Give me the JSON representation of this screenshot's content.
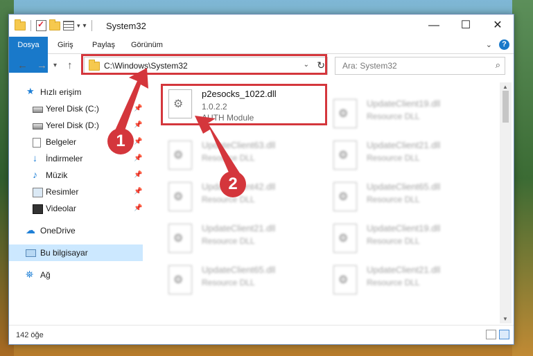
{
  "window": {
    "title": "System32"
  },
  "ribbon": {
    "tabs": [
      "Dosya",
      "Giriş",
      "Paylaş",
      "Görünüm"
    ]
  },
  "address": {
    "path": "C:\\Windows\\System32"
  },
  "search": {
    "placeholder": "Ara: System32"
  },
  "sidebar": {
    "quick_access": "Hızlı erişim",
    "items": [
      "Yerel Disk (C:)",
      "Yerel Disk (D:)",
      "Belgeler",
      "İndirmeler",
      "Müzik",
      "Resimler",
      "Videolar"
    ],
    "onedrive": "OneDrive",
    "this_pc": "Bu bilgisayar",
    "network": "Ağ"
  },
  "files": {
    "main": {
      "name": "p2esocks_1022.dll",
      "version": "1.0.2.2",
      "description": "AUTH Module"
    },
    "blurred": [
      {
        "name": "UpdateClient63.dll",
        "type": "Resource DLL"
      },
      {
        "name": "UpdateClient42.dll",
        "type": "Resource DLL"
      },
      {
        "name": "UpdateClient21.dll",
        "type": "Resource DLL"
      },
      {
        "name": "UpdateClient65.dll",
        "type": "Resource DLL"
      },
      {
        "name": "UpdateClient19.dll",
        "type": "Resource DLL"
      },
      {
        "name": "UpdateClient21.dll",
        "type": "Resource DLL"
      },
      {
        "name": "UpdateClient65.dll",
        "type": "Resource DLL"
      },
      {
        "name": "UpdateClient19.dll",
        "type": "Resource DLL"
      },
      {
        "name": "UpdateClient21.dll",
        "type": "Resource DLL"
      }
    ]
  },
  "status": {
    "count": "142 öğe"
  },
  "annotations": {
    "badge1": "1",
    "badge2": "2",
    "color": "#d4363c"
  }
}
